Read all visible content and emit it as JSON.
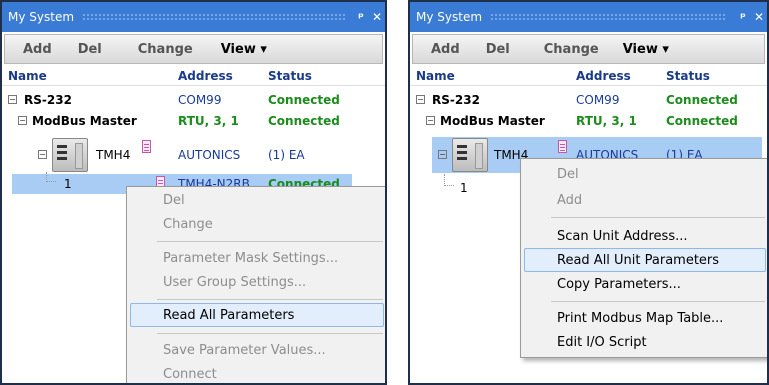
{
  "panels": [
    {
      "title": "My System",
      "toolbar": {
        "add": "Add",
        "del": "Del",
        "change": "Change",
        "view": "View ▾"
      },
      "columns": {
        "name": "Name",
        "address": "Address",
        "status": "Status"
      },
      "rows": {
        "rs232": {
          "name": "RS-232",
          "address": "COM99",
          "status": "Connected"
        },
        "master": {
          "name": "ModBus Master",
          "address": "RTU, 3, 1",
          "status": "Connected"
        },
        "device": {
          "name": "TMH4",
          "address": "AUTONICS",
          "status": "(1) EA"
        },
        "unit": {
          "name": "1",
          "address": "TMH4-N2RB",
          "status": "Connected"
        }
      },
      "menu": {
        "del": "Del",
        "change": "Change",
        "param_mask": "Parameter Mask Settings...",
        "user_group": "User Group Settings...",
        "read_all": "Read All Parameters",
        "save_values": "Save Parameter Values...",
        "connect": "Connect"
      }
    },
    {
      "title": "My System",
      "toolbar": {
        "add": "Add",
        "del": "Del",
        "change": "Change",
        "view": "View ▾"
      },
      "columns": {
        "name": "Name",
        "address": "Address",
        "status": "Status"
      },
      "rows": {
        "rs232": {
          "name": "RS-232",
          "address": "COM99",
          "status": "Connected"
        },
        "master": {
          "name": "ModBus Master",
          "address": "RTU, 3, 1",
          "status": "Connected"
        },
        "device": {
          "name": "TMH4",
          "address": "AUTONICS",
          "status": "(1) EA"
        },
        "unit": {
          "name": "1"
        }
      },
      "menu": {
        "del": "Del",
        "add": "Add",
        "scan": "Scan Unit Address...",
        "read_unit": "Read All Unit Parameters",
        "copy": "Copy Parameters...",
        "print_map": "Print Modbus Map Table...",
        "edit_io": "Edit I/O Script"
      }
    }
  ],
  "icons": {
    "pin": "pin-icon",
    "close": "close-icon",
    "expander": "collapse-icon",
    "device": "controller-device-icon",
    "doc": "document-icon"
  },
  "colors": {
    "titlebar": "#3a7bd5",
    "connected": "#1c8c1c",
    "address": "#1a3a9a",
    "selection": "#a9ccf5",
    "highlight": "#e3eefc"
  }
}
